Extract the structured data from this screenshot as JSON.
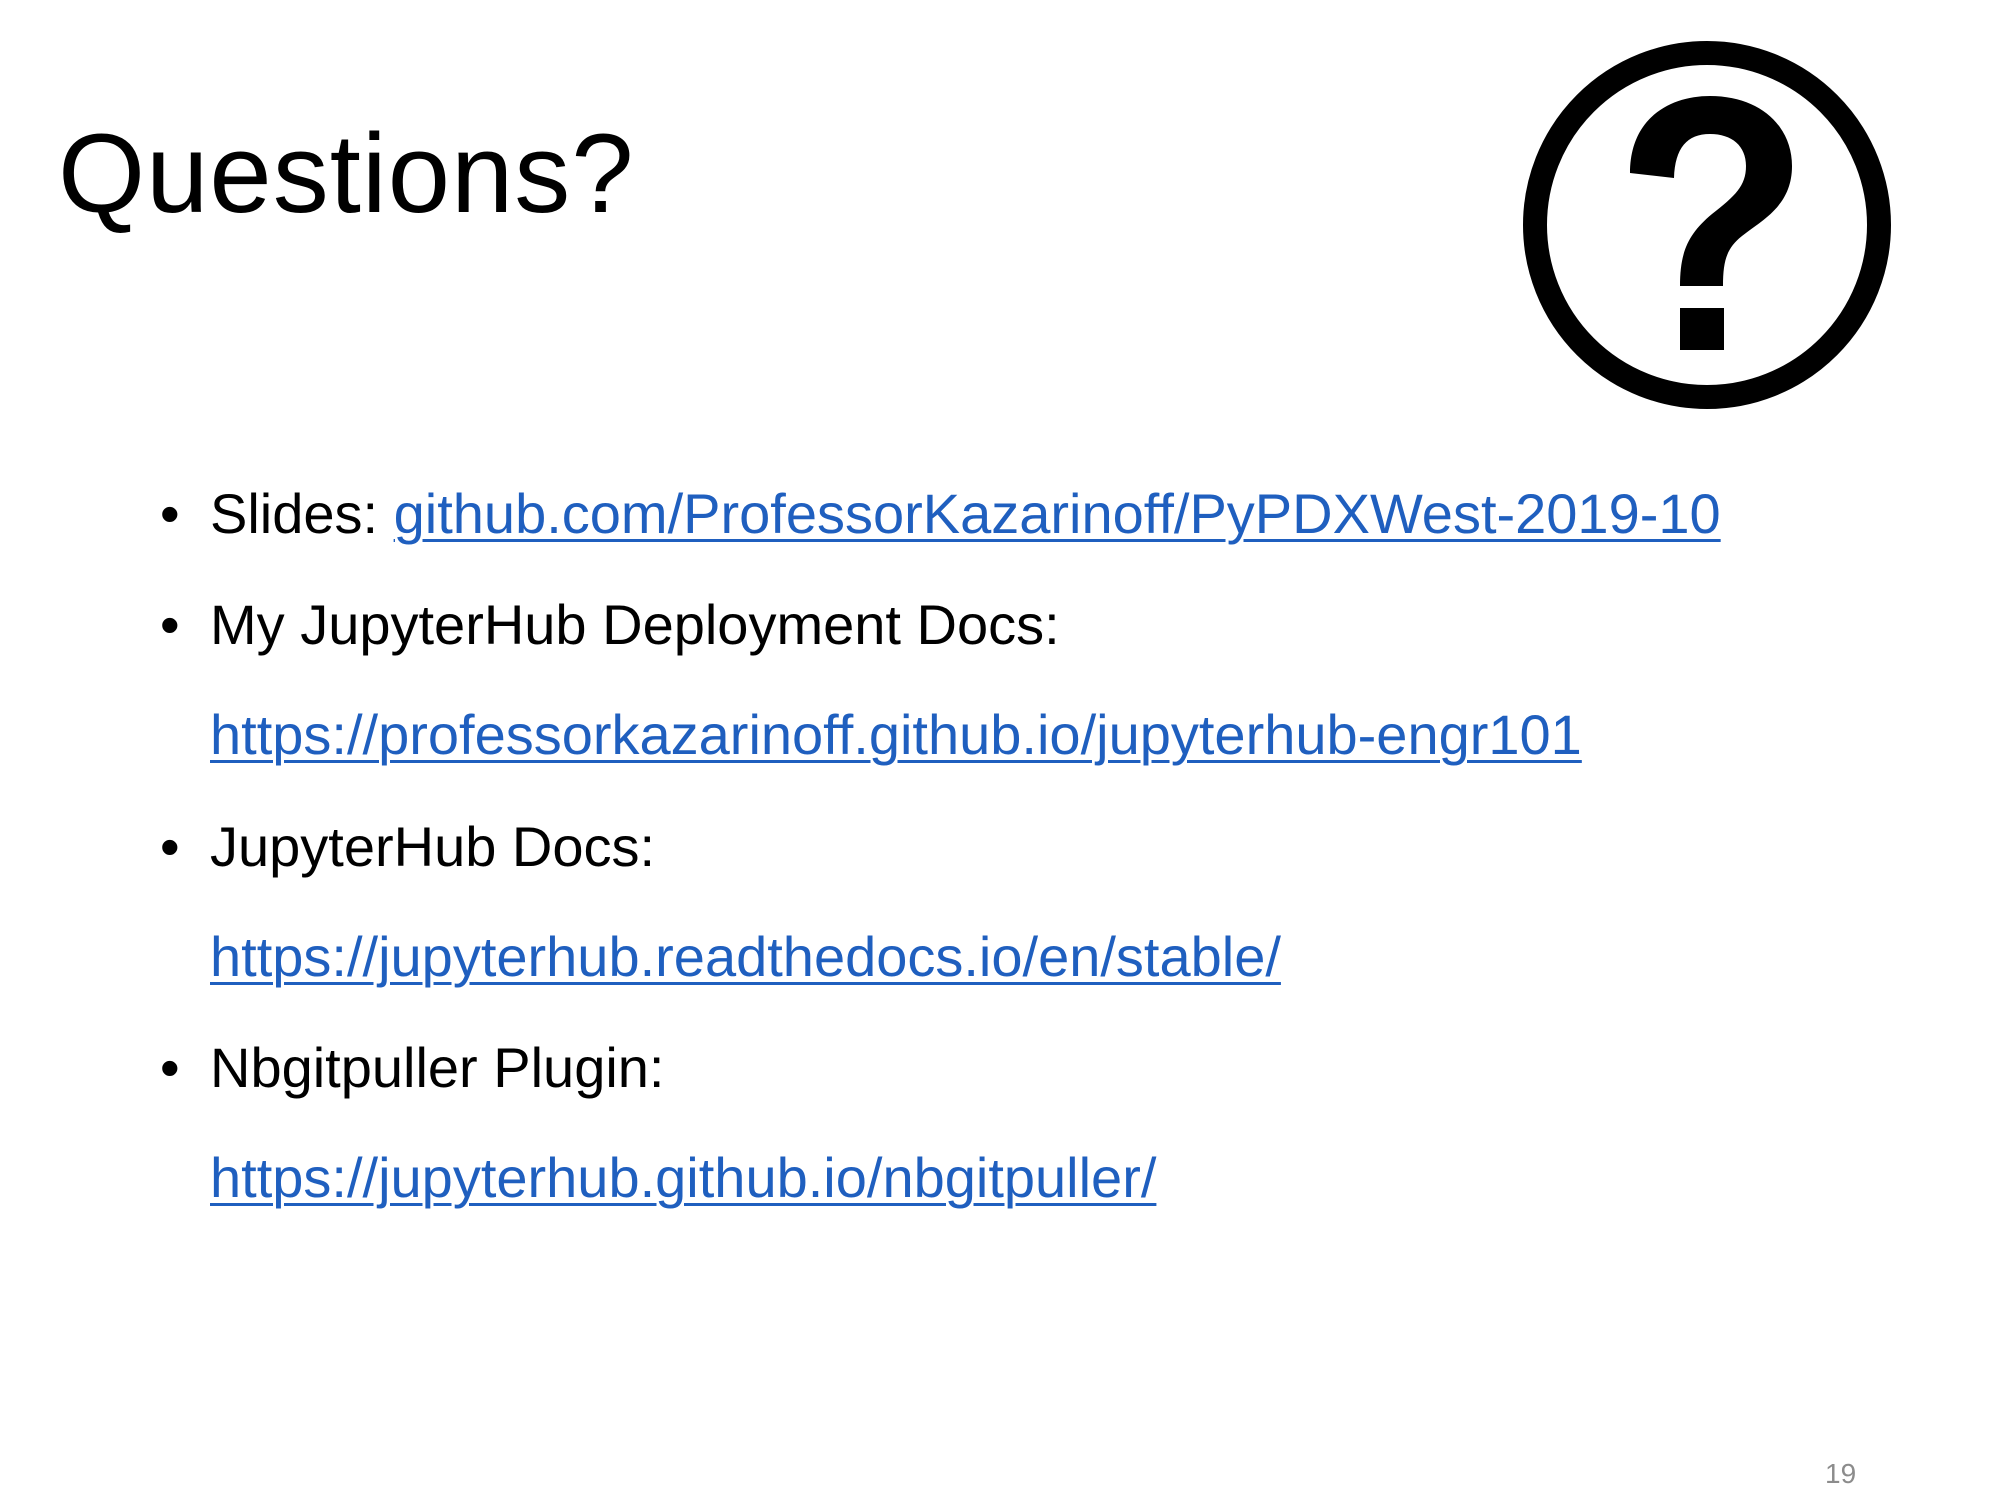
{
  "slide": {
    "title": "Questions?",
    "icon": "question-circle-icon",
    "page_number": "19",
    "link_color": "#1f5fbf",
    "bullets": [
      {
        "label": "Slides: ",
        "link": "github.com/ProfessorKazarinoff/PyPDXWest-2019-10"
      },
      {
        "label": "My JupyterHub Deployment Docs:",
        "link": "https://professorkazarinoff.github.io/jupyterhub-engr101"
      },
      {
        "label": "JupyterHub Docs:",
        "link": "https://jupyterhub.readthedocs.io/en/stable/"
      },
      {
        "label": "Nbgitpuller Plugin:",
        "link": "https://jupyterhub.github.io/nbgitpuller/"
      }
    ]
  }
}
